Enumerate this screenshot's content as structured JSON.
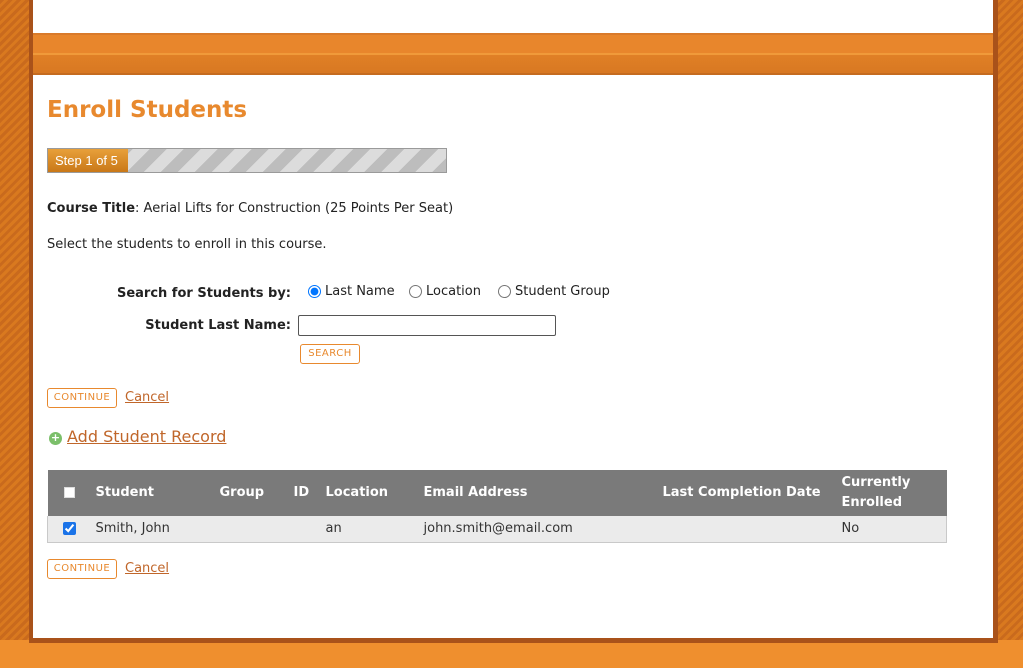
{
  "page": {
    "title": "Enroll Students",
    "progress": {
      "label": "Step 1 of 5",
      "current_step": 1,
      "total_steps": 5
    },
    "course": {
      "label": "Course Title",
      "value": "Aerial Lifts for Construction (25 Points Per Seat)"
    },
    "instructions": "Select the students to enroll in this course."
  },
  "search": {
    "by_label": "Search for Students by:",
    "options": [
      {
        "label": "Last Name",
        "selected": true
      },
      {
        "label": "Location",
        "selected": false
      },
      {
        "label": "Student Group",
        "selected": false
      }
    ],
    "last_name_label": "Student Last Name:",
    "last_name_value": "",
    "search_button": "SEARCH"
  },
  "actions": {
    "continue": "CONTINUE",
    "cancel": "Cancel",
    "add_student": "Add Student Record"
  },
  "table": {
    "columns": [
      "Student",
      "Group",
      "ID",
      "Location",
      "Email Address",
      "Last Completion Date",
      "Currently Enrolled"
    ],
    "rows": [
      {
        "checked": true,
        "student": "Smith, John",
        "group": "",
        "id": "",
        "location": "an",
        "email": "john.smith@email.com",
        "last_completion": "",
        "enrolled": "No"
      }
    ]
  },
  "colors": {
    "accent": "#e8892e",
    "link": "#c0662a",
    "header_bg": "#7a7a7a"
  }
}
